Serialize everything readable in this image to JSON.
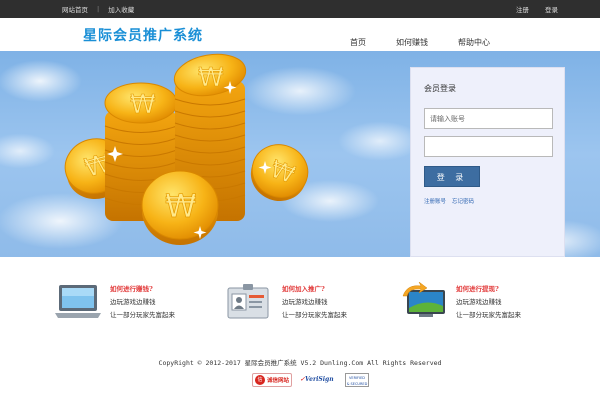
{
  "topbar": {
    "home_link": "网站首页",
    "separator": "|",
    "bookmark_link": "加入收藏",
    "register_link": "注册",
    "login_link": "登录"
  },
  "header": {
    "logo": "星际会员推广系统",
    "nav": [
      "首页",
      "如何赚钱",
      "帮助中心"
    ]
  },
  "banner": {
    "coin_symbol": "₩",
    "colors": {
      "sky": "#8fbbe9",
      "coin": "#f7b316",
      "coin_dark": "#e08a00"
    }
  },
  "login": {
    "title": "会员登录",
    "account_placeholder": "请输入账号",
    "password_value": "",
    "button_label": "登 录",
    "register_link": "注册账号",
    "forgot_link": "忘记密码",
    "colors": {
      "button": "#3d6da1",
      "panel": "#eef0fb"
    }
  },
  "features": [
    {
      "icon": "laptop-icon",
      "title": "如何进行赚钱?",
      "line1": "边玩游戏边赚钱",
      "line2": "让一部分玩家先富起来"
    },
    {
      "icon": "id-card-icon",
      "title": "如何加入推广?",
      "line1": "边玩游戏边赚钱",
      "line2": "让一部分玩家先富起来"
    },
    {
      "icon": "monitor-arrow-icon",
      "title": "如何进行提现?",
      "line1": "边玩游戏边赚钱",
      "line2": "让一部分玩家先富起来"
    }
  ],
  "footer": {
    "copyright": "CopyRight © 2012-2017 星际会员推广系统 V5.2 Dunling.Com All Rights Reserved",
    "badge_chengxin_seal": "信",
    "badge_chengxin": "诚信网站",
    "badge_verisign": "VeriSign",
    "badge_verified_line1": "VERIFIED",
    "badge_verified_line2": "& SECURED"
  }
}
